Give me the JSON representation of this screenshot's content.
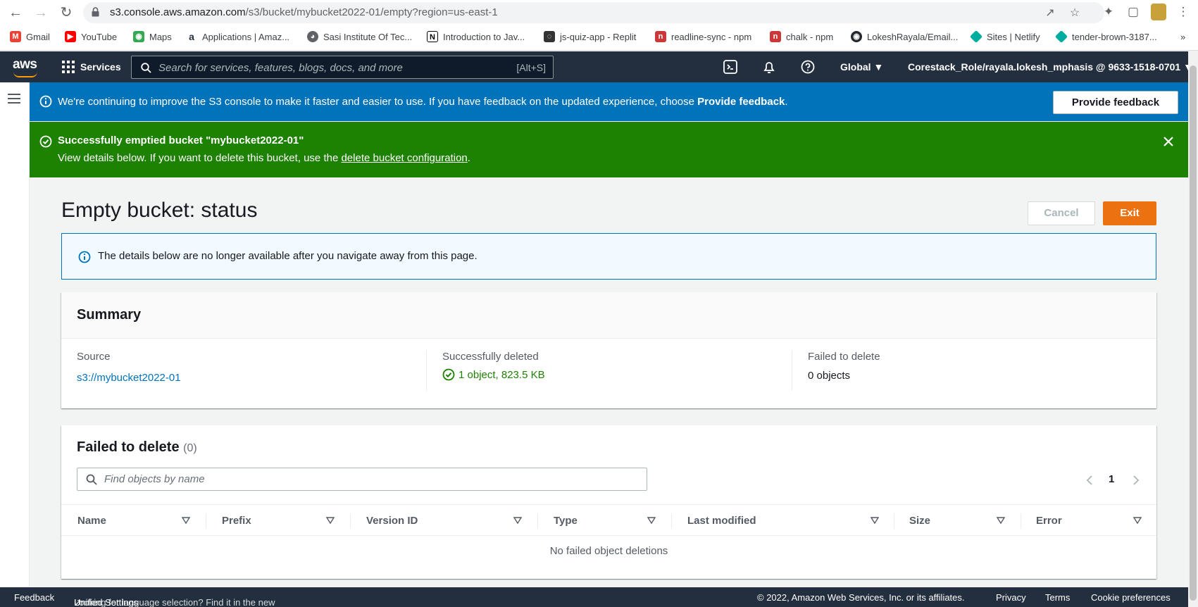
{
  "browser": {
    "url_host": "s3.console.aws.amazon.com",
    "url_path": "/s3/bucket/mybucket2022-01/empty?region=us-east-1",
    "bookmarks": [
      {
        "label": "Gmail",
        "icon": "gmail-icon",
        "color": "#ea4335"
      },
      {
        "label": "YouTube",
        "icon": "youtube-icon",
        "color": "#ff0000"
      },
      {
        "label": "Maps",
        "icon": "maps-icon",
        "color": "#34a853"
      },
      {
        "label": "Applications | Amaz...",
        "icon": "amazon-icon",
        "color": "#232f3e"
      },
      {
        "label": "Sasi Institute Of Tec...",
        "icon": "globe-icon",
        "color": "#5f6368"
      },
      {
        "label": "Introduction to Jav...",
        "icon": "notion-icon",
        "color": "#000000"
      },
      {
        "label": "js-quiz-app - Replit",
        "icon": "replit-icon",
        "color": "#333333"
      },
      {
        "label": "readline-sync - npm",
        "icon": "npm-icon",
        "color": "#cb3837"
      },
      {
        "label": "chalk - npm",
        "icon": "npm-icon",
        "color": "#cb3837"
      },
      {
        "label": "LokeshRayala/Email...",
        "icon": "github-icon",
        "color": "#24292f"
      },
      {
        "label": "Sites | Netlify",
        "icon": "netlify-icon",
        "color": "#00ad9f"
      },
      {
        "label": "tender-brown-3187...",
        "icon": "netlify-icon",
        "color": "#00ad9f"
      }
    ],
    "more_bookmarks": "»"
  },
  "aws_nav": {
    "logo": "aws",
    "services": "Services",
    "search_placeholder": "Search for services, features, blogs, docs, and more",
    "search_shortcut": "[Alt+S]",
    "region": "Global",
    "account": "Corestack_Role/rayala.lokesh_mphasis @ 9633-1518-0701"
  },
  "banners": {
    "info_text": "We're continuing to improve the S3 console to make it faster and easier to use. If you have feedback on the updated experience, choose ",
    "info_bold": "Provide feedback",
    "info_end": ".",
    "feedback_button": "Provide feedback",
    "success_title": "Successfully emptied bucket \"mybucket2022-01\"",
    "success_body_pre": "View details below. If you want to delete this bucket, use the ",
    "success_link": "delete bucket configuration",
    "success_body_post": "."
  },
  "page": {
    "title": "Empty bucket: status",
    "cancel": "Cancel",
    "exit": "Exit",
    "alert": "The details below are no longer available after you navigate away from this page."
  },
  "summary": {
    "title": "Summary",
    "source_label": "Source",
    "source_value": "s3://mybucket2022-01",
    "deleted_label": "Successfully deleted",
    "deleted_value": "1 object, 823.5 KB",
    "failed_label": "Failed to delete",
    "failed_value": "0 objects"
  },
  "failed": {
    "title": "Failed to delete",
    "count": "(0)",
    "search_placeholder": "Find objects by name",
    "page": "1",
    "columns": [
      "Name",
      "Prefix",
      "Version ID",
      "Type",
      "Last modified",
      "Size",
      "Error"
    ],
    "empty": "No failed object deletions"
  },
  "footer": {
    "feedback": "Feedback",
    "language_pre": "Looking for language selection? Find it in the new ",
    "language_link": "Unified Settings",
    "copyright": "© 2022, Amazon Web Services, Inc. or its affiliates.",
    "privacy": "Privacy",
    "terms": "Terms",
    "cookies": "Cookie preferences"
  },
  "colors": {
    "aws_nav": "#232f3e",
    "info_banner": "#0073bb",
    "success_banner": "#1d8102",
    "primary_button": "#ec7211",
    "link": "#0073bb"
  }
}
